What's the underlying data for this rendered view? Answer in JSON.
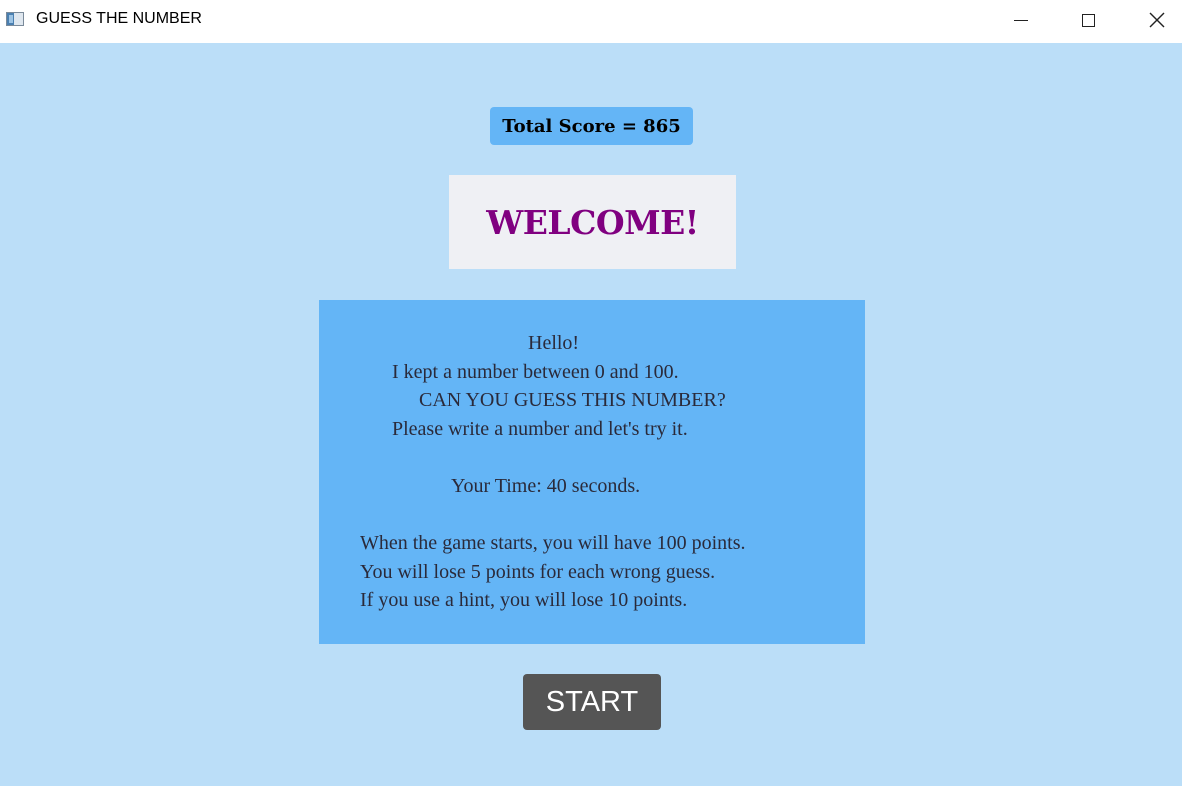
{
  "window": {
    "title": "GUESS THE NUMBER",
    "controls": {
      "minimize_icon": "minimize-icon",
      "maximize_icon": "maximize-icon",
      "close_icon": "close-icon"
    }
  },
  "score": {
    "label": "Total Score = 865"
  },
  "welcome": {
    "text": "WELCOME!"
  },
  "info": {
    "lines": [
      "Hello!",
      "I kept a number between 0 and 100.",
      "CAN YOU GUESS THIS NUMBER?",
      "Please write a number and let's try it.",
      "Your Time: 40 seconds.",
      "When the game starts, you will have 100 points.",
      "You will lose 5 points for each wrong guess.",
      "If you use a hint, you will lose 10 points."
    ]
  },
  "start_button": {
    "label": "START"
  },
  "colors": {
    "background": "#bbdef8",
    "accent": "#64b5f6",
    "welcome_text": "#800080",
    "welcome_box": "#eff0f4",
    "button": "#555555"
  }
}
